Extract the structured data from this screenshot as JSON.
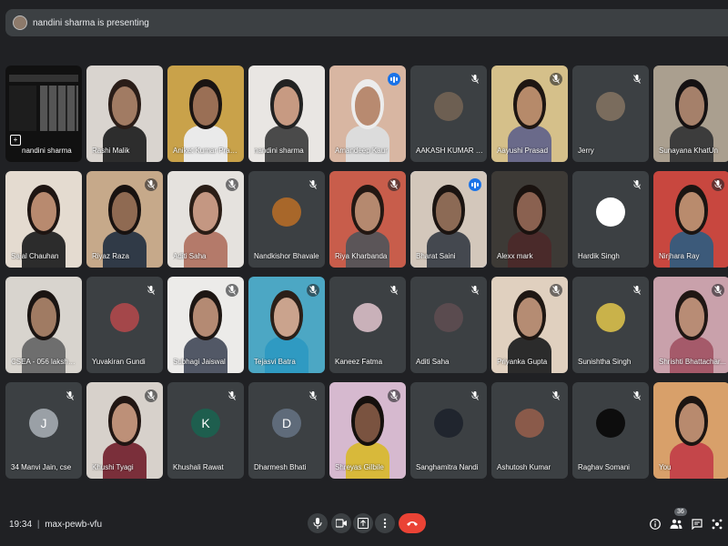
{
  "header": {
    "presenting_text": "nandini sharma is presenting"
  },
  "tiles": [
    {
      "name": "nandini sharma",
      "type": "screen"
    },
    {
      "name": "Rashi Malik",
      "type": "video",
      "skin": "#a17b63",
      "hair": "#2a1d18",
      "bg": "#d9d4cf",
      "shirt": "#2d2d2d"
    },
    {
      "name": "Aniket Kumar Prasad",
      "type": "video",
      "skin": "#9a6f55",
      "hair": "#1a1412",
      "bg": "#c9a24a",
      "shirt": "#eaeaea"
    },
    {
      "name": "nandini sharma",
      "type": "video",
      "skin": "#c79a82",
      "hair": "#222",
      "bg": "#e9e6e3",
      "shirt": "#4a4a4a"
    },
    {
      "name": "Amandeep Kaur",
      "type": "video",
      "skin": "#b88a70",
      "hair": "#ececec",
      "bg": "#d8b6a2",
      "shirt": "#dcdcdc",
      "speaking_icon": true
    },
    {
      "name": "AAKASH KUMAR SIN...",
      "type": "avatar",
      "avatar_color": "#6d5f52",
      "muted": true
    },
    {
      "name": "Aayushi Prasad",
      "type": "video",
      "skin": "#b68a6a",
      "hair": "#1e1612",
      "bg": "#d5c08a",
      "shirt": "#6a6a8a",
      "muted": true
    },
    {
      "name": "Jerry",
      "type": "avatar",
      "avatar_color": "#7a6c5d",
      "muted": true
    },
    {
      "name": "Sunayana KhatUn",
      "type": "video",
      "skin": "#a5806a",
      "hair": "#151112",
      "bg": "#aa9f8f",
      "shirt": "#3c3c3c"
    },
    {
      "name": "Sajal Chauhan",
      "type": "video",
      "skin": "#b88a6f",
      "hair": "#1e1512",
      "bg": "#e4dbd0",
      "shirt": "#2c2c2c"
    },
    {
      "name": "Riyaz Raza",
      "type": "video",
      "skin": "#8f6a52",
      "hair": "#181210",
      "bg": "#c6a98a",
      "shirt": "#303a47",
      "muted": true
    },
    {
      "name": "Aditi Saha",
      "type": "video",
      "skin": "#c49782",
      "hair": "#2a1d16",
      "bg": "#e5e2de",
      "shirt": "#b47a6a",
      "muted": true
    },
    {
      "name": "Nandkishor Bhavale",
      "type": "avatar",
      "avatar_color": "#a8672a",
      "muted": true
    },
    {
      "name": "Riya Kharbanda",
      "type": "video",
      "skin": "#b5896f",
      "hair": "#231813",
      "bg": "#c85d4b",
      "shirt": "#5b5558",
      "muted": true
    },
    {
      "name": "Bharat Saini",
      "type": "video",
      "skin": "#8c6a55",
      "hair": "#1b1411",
      "bg": "#d3c7bb",
      "shirt": "#44484f",
      "speaking_icon": true,
      "speaking": true
    },
    {
      "name": "Alexx mark",
      "type": "video",
      "skin": "#8a6150",
      "hair": "#1a120f",
      "bg": "#3d3a36",
      "shirt": "#4a2a2a"
    },
    {
      "name": "Hardik Singh",
      "type": "avatar",
      "avatar_color": "#ffffff",
      "muted": true
    },
    {
      "name": "Nirjhara Ray",
      "type": "video",
      "skin": "#b98b6d",
      "hair": "#1b1512",
      "bg": "#c8473f",
      "shirt": "#3c5a7a",
      "muted": true
    },
    {
      "name": "CSEA - 056 lakshya ...",
      "type": "video",
      "skin": "#a07b63",
      "hair": "#1a1412",
      "bg": "#d8d4ce",
      "shirt": "#6e6e6e"
    },
    {
      "name": "Yuvakiran Gundi",
      "type": "avatar",
      "avatar_color": "#a4474a",
      "muted": true
    },
    {
      "name": "Subhagi Jaiswal",
      "type": "video",
      "skin": "#b48a73",
      "hair": "#1d1613",
      "bg": "#ecebe9",
      "shirt": "#525866",
      "muted": true
    },
    {
      "name": "Tejasvi Batra",
      "type": "video",
      "skin": "#caa38d",
      "hair": "#2b1f18",
      "bg": "#4ca7c4",
      "shirt": "#2f9ac2",
      "muted": true
    },
    {
      "name": "Kaneez Fatma",
      "type": "avatar",
      "avatar_color": "#c9b1b9",
      "muted": true
    },
    {
      "name": "Aditi Saha",
      "type": "avatar",
      "avatar_color": "#5a4b4f",
      "muted": true
    },
    {
      "name": "Priyanka Gupta",
      "type": "video",
      "skin": "#b58c73",
      "hair": "#1f1713",
      "bg": "#e0d0bf",
      "shirt": "#2b2b2b",
      "muted": true
    },
    {
      "name": "Sunishtha Singh",
      "type": "avatar",
      "avatar_color": "#c9b24a",
      "muted": true
    },
    {
      "name": "Shrishti Bhattachar...",
      "type": "video",
      "skin": "#b88c75",
      "hair": "#201714",
      "bg": "#c9a1ab",
      "shirt": "#a55a6a",
      "muted": true
    },
    {
      "name": "34 Manvi Jain, cse",
      "type": "letter",
      "letter": "J",
      "avatar_color": "#9aa0a6",
      "muted": true
    },
    {
      "name": "Khushi Tyagi",
      "type": "video",
      "skin": "#bd9078",
      "hair": "#211613",
      "bg": "#d7d1cb",
      "shirt": "#7a2f3a",
      "muted": true
    },
    {
      "name": "Khushali Rawat",
      "type": "letter",
      "letter": "K",
      "avatar_color": "#1e5e4e",
      "muted": true
    },
    {
      "name": "Dharmesh Bhati",
      "type": "letter",
      "letter": "D",
      "avatar_color": "#5f6b7a",
      "muted": true
    },
    {
      "name": "Shreyas Gilbile",
      "type": "video",
      "skin": "#7a5340",
      "hair": "#15100d",
      "bg": "#d6b9cf",
      "shirt": "#d8b93a",
      "muted": true
    },
    {
      "name": "Sanghamitra Nandi",
      "type": "avatar",
      "avatar_color": "#20252e",
      "muted": true
    },
    {
      "name": "Ashutosh Kumar",
      "type": "avatar",
      "avatar_color": "#8a5a4a",
      "muted": true
    },
    {
      "name": "Raghav Somani",
      "type": "avatar",
      "avatar_color": "#0d0d0d",
      "muted": true
    },
    {
      "name": "You",
      "type": "video",
      "skin": "#b88a6e",
      "hair": "#1c1512",
      "bg": "#d8a06a",
      "shirt": "#c4464a"
    }
  ],
  "bottom": {
    "time": "19:34",
    "separator": "|",
    "meeting_code": "max-pewb-vfu",
    "participant_count": "36"
  },
  "colors": {
    "background": "#202124",
    "tile": "#3c4043",
    "accent": "#8ab4f8",
    "end_call": "#ea4335"
  }
}
